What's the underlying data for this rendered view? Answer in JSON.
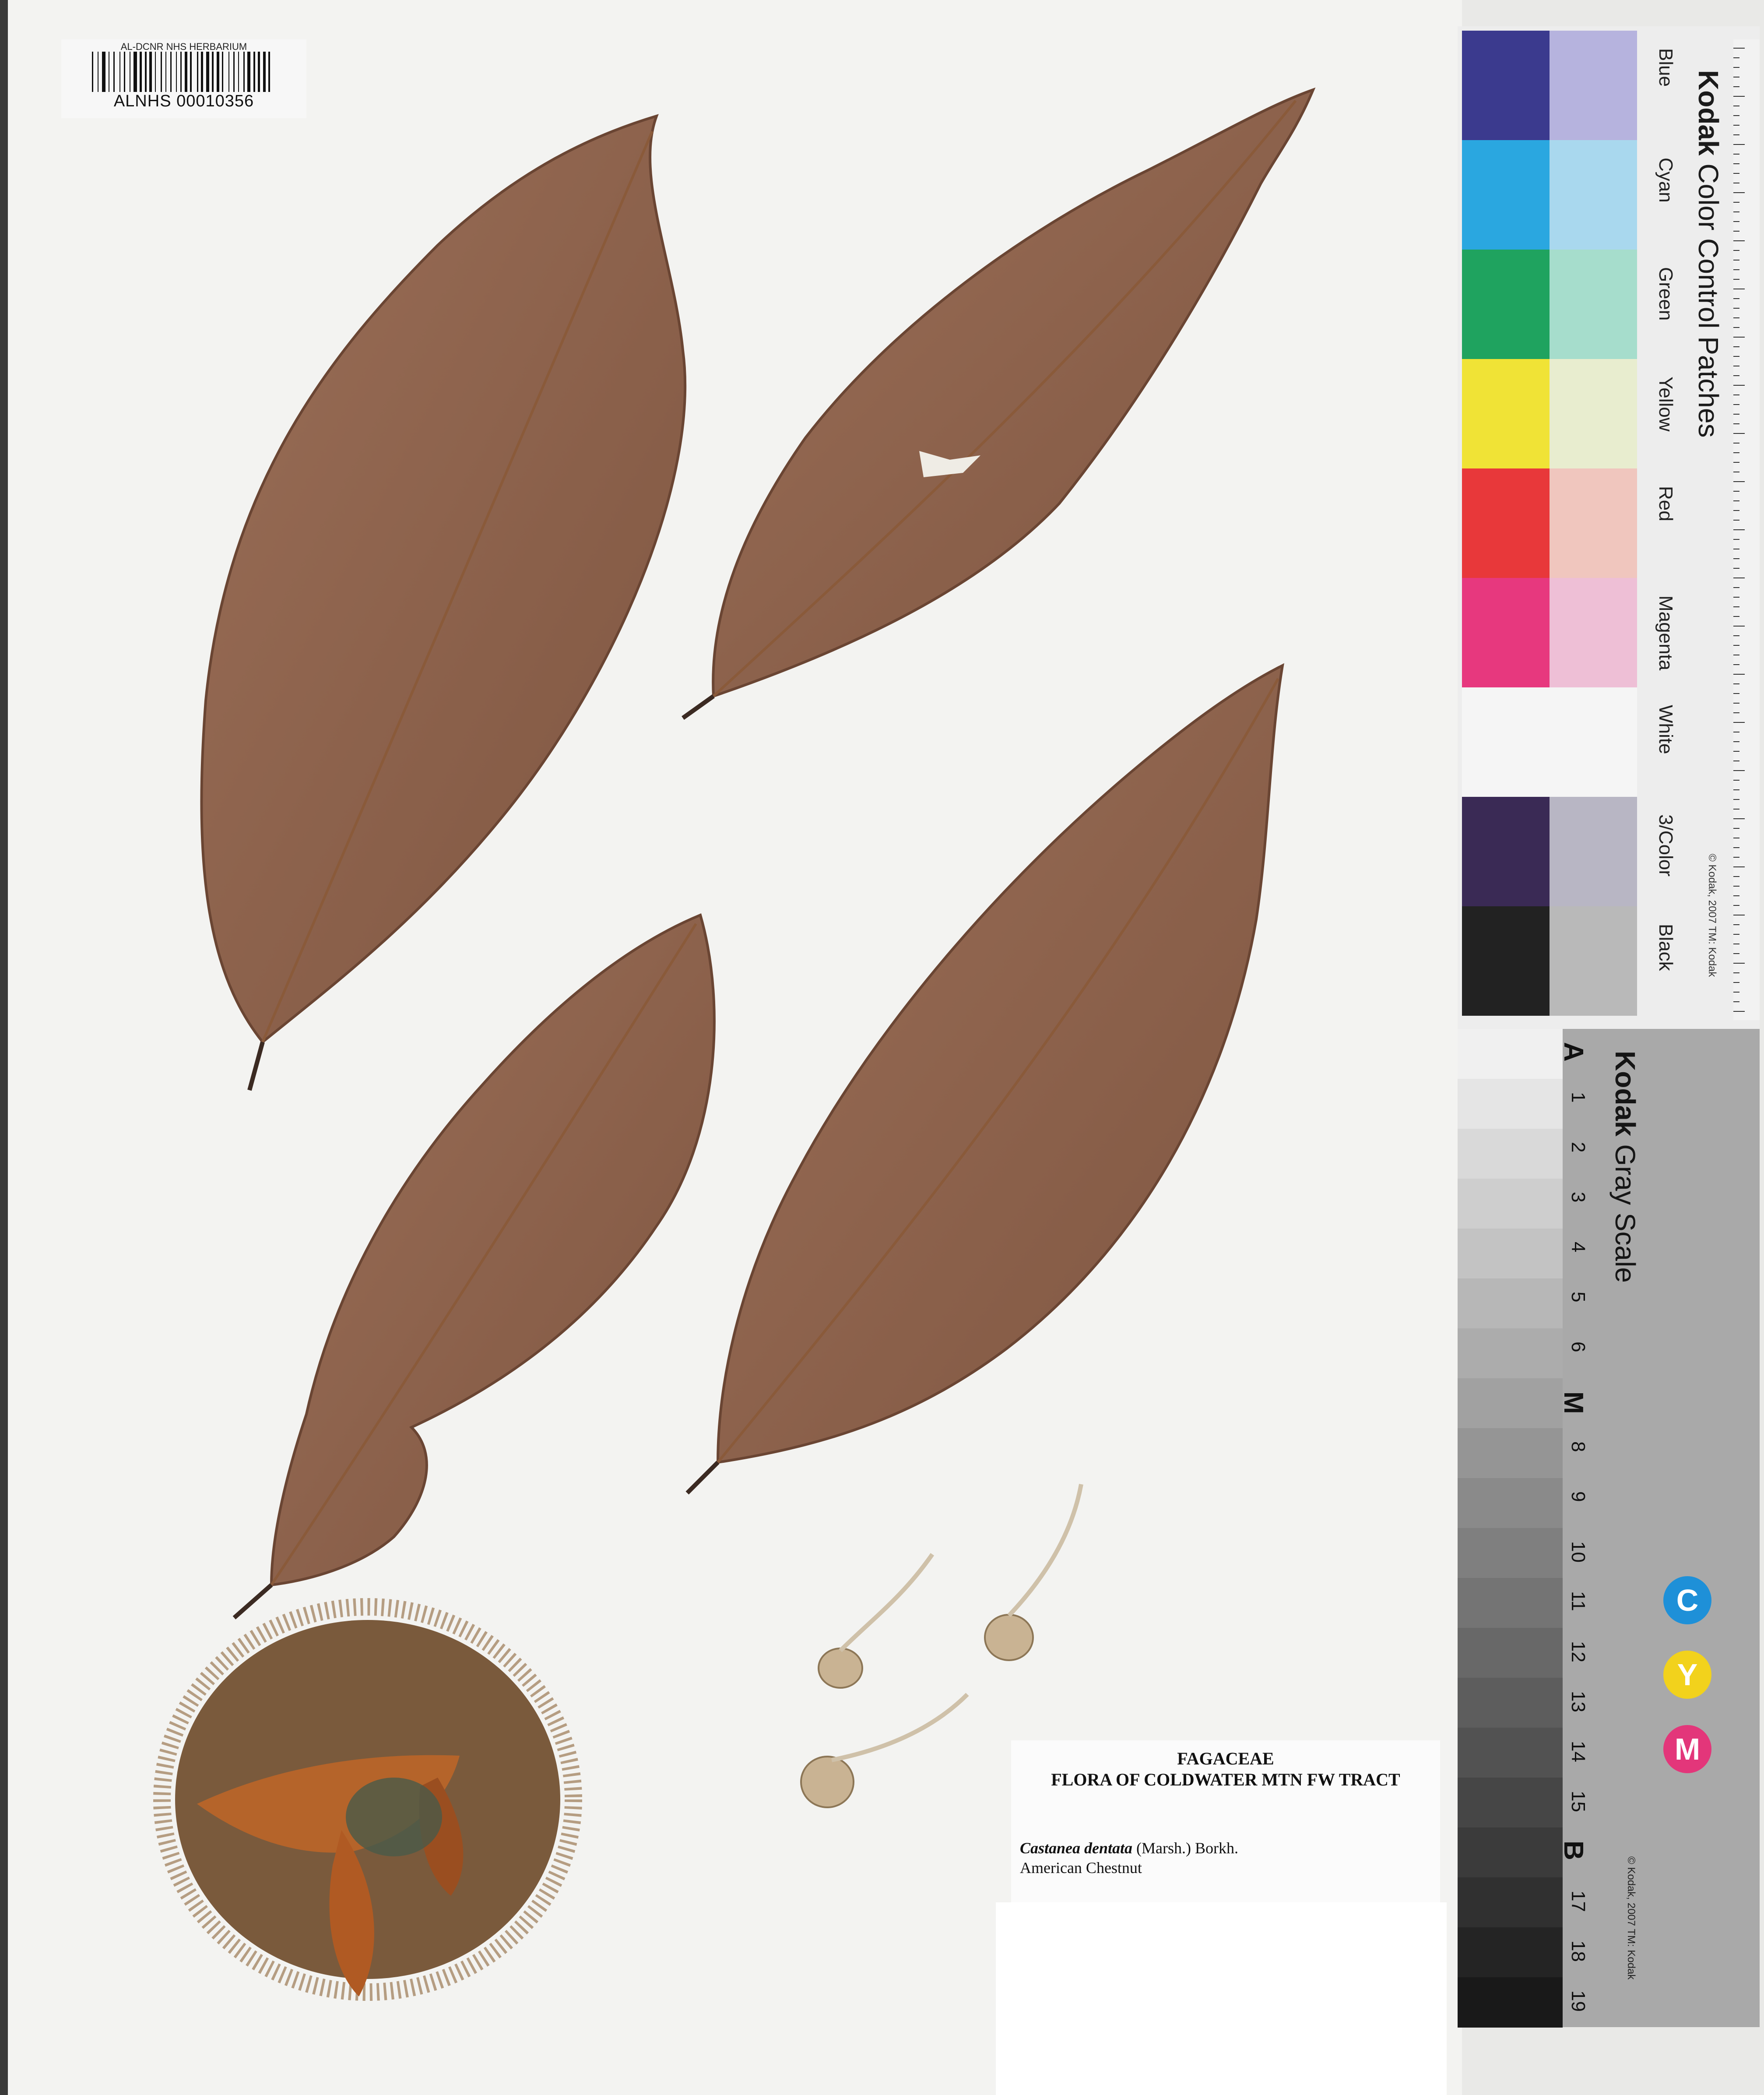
{
  "barcode_label": {
    "header": "AL-DCNR NHS HERBARIUM",
    "number": "ALNHS 00010356"
  },
  "herbarium_label": {
    "family": "FAGACEAE",
    "project": "FLORA OF COLDWATER MTN FW TRACT",
    "scientific_name": "Castanea dentata",
    "authority": "(Marsh.) Borkh.",
    "common_name": "American Chestnut"
  },
  "color_card": {
    "brand": "Kodak",
    "title": "Color Control Patches",
    "copyright": "© Kodak, 2007 TM: Kodak",
    "ruler_units": [
      "cm",
      "inches"
    ],
    "patches": [
      {
        "name": "Blue",
        "dark": "#3b3a8e",
        "light": "#b6b3de"
      },
      {
        "name": "Cyan",
        "dark": "#2aa7e0",
        "light": "#a9d8ee"
      },
      {
        "name": "Green",
        "dark": "#1fa35f",
        "light": "#a6ddcc"
      },
      {
        "name": "Yellow",
        "dark": "#f0e336",
        "light": "#e8edcf"
      },
      {
        "name": "Red",
        "dark": "#e8383a",
        "light": "#f0c6be"
      },
      {
        "name": "Magenta",
        "dark": "#e7387e",
        "light": "#eebfd6"
      },
      {
        "name": "White",
        "dark": "#f5f5f5",
        "light": "#f5f5f5"
      },
      {
        "name": "3/Color",
        "dark": "#3a2a55",
        "light": "#b8b6c4"
      },
      {
        "name": "Black",
        "dark": "#222222",
        "light": "#b9b9b9"
      }
    ]
  },
  "gray_card": {
    "brand": "Kodak",
    "title": "Gray Scale",
    "copyright": "© Kodak, 2007 TM: Kodak",
    "steps": [
      "A",
      "1",
      "2",
      "3",
      "4",
      "5",
      "6",
      "M",
      "8",
      "9",
      "10",
      "11",
      "12",
      "13",
      "14",
      "15",
      "B",
      "17",
      "18",
      "19"
    ],
    "cmy": [
      "C",
      "Y",
      "M"
    ],
    "cmy_colors": [
      "#1e90d8",
      "#f2d21c",
      "#e3367a"
    ]
  }
}
